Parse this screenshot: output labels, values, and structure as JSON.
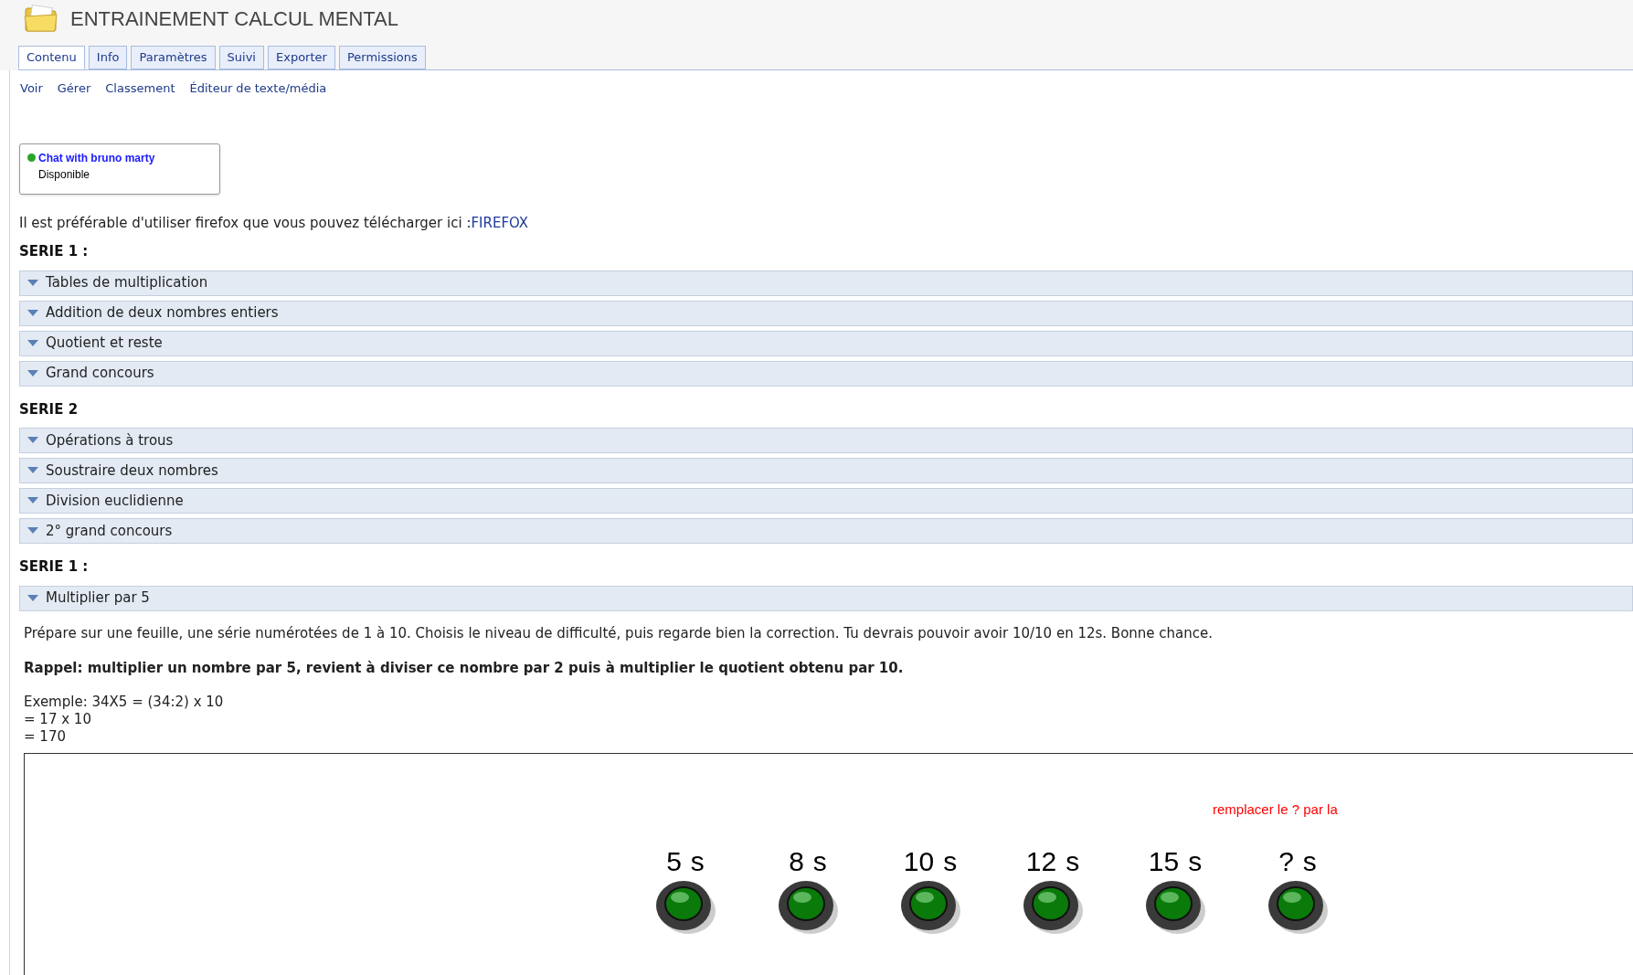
{
  "page": {
    "title": "ENTRAINEMENT CALCUL MENTAL"
  },
  "tabs": [
    {
      "label": "Contenu",
      "selected": true
    },
    {
      "label": "Info",
      "selected": false
    },
    {
      "label": "Paramètres",
      "selected": false
    },
    {
      "label": "Suivi",
      "selected": false
    },
    {
      "label": "Exporter",
      "selected": false
    },
    {
      "label": "Permissions",
      "selected": false
    }
  ],
  "subnav": [
    "Voir",
    "Gérer",
    "Classement",
    "Éditeur de texte/média"
  ],
  "chat": {
    "name": "Chat with bruno marty",
    "status": "Disponible",
    "online": true
  },
  "intro": {
    "text": "Il est préférable d'utiliser firefox que vous pouvez télécharger ici :",
    "link": "FIREFOX"
  },
  "sections": [
    {
      "heading": "SERIE 1 :",
      "items": [
        {
          "label": "Tables de multiplication"
        },
        {
          "label": "Addition de deux nombres entiers"
        },
        {
          "label": "Quotient et reste"
        },
        {
          "label": "Grand concours"
        }
      ]
    },
    {
      "heading": "SERIE 2",
      "items": [
        {
          "label": "Opérations à trous"
        },
        {
          "label": "Soustraire deux nombres"
        },
        {
          "label": "Division euclidienne"
        },
        {
          "label": "2° grand concours"
        }
      ]
    },
    {
      "heading": "SERIE 1 :",
      "items": [
        {
          "label": "Multiplier par 5",
          "content": {
            "instructions": "Prépare sur une feuille, une série numérotées de 1 à 10. Choisis le niveau de difficulté, puis regarde bien la correction. Tu devrais pouvoir avoir 10/10 en 12s. Bonne chance.",
            "reminder": "Rappel: multiplier un nombre par 5, revient à diviser ce nombre par 2 puis à multiplier le quotient obtenu par 10.",
            "example_lines": [
              "Exemple: 34X5 = (34:2) x 10",
              "= 17 x 10",
              "= 170"
            ],
            "exercise": {
              "hint": "remplacer le ? par la",
              "timers": [
                {
                  "value": "5",
                  "unit": "s"
                },
                {
                  "value": "8",
                  "unit": "s"
                },
                {
                  "value": "10",
                  "unit": "s"
                },
                {
                  "value": "12",
                  "unit": "s"
                },
                {
                  "value": "15",
                  "unit": "s"
                },
                {
                  "value": "?",
                  "unit": "s"
                }
              ]
            }
          }
        }
      ]
    }
  ]
}
